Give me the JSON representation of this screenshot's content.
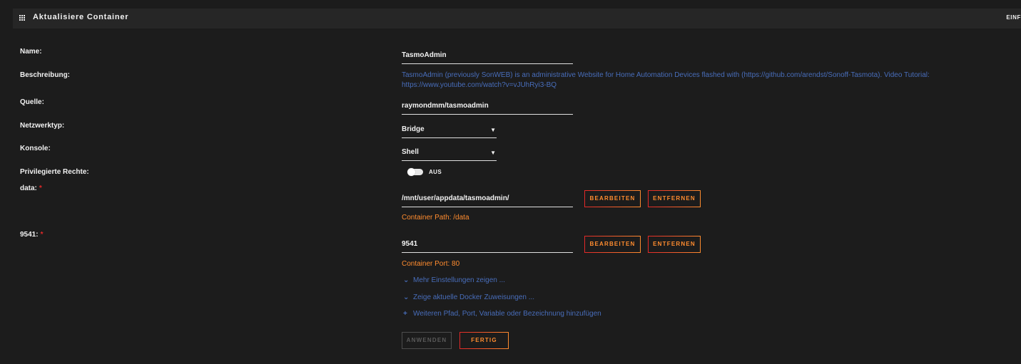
{
  "window": {
    "title": "Aktualisiere Container",
    "right_tab": "EINF"
  },
  "form": {
    "name": {
      "label": "Name:",
      "value": "TasmoAdmin"
    },
    "description": {
      "label": "Beschreibung:",
      "value": "TasmoAdmin (previously SonWEB) is an administrative Website for Home Automation Devices flashed with (https://github.com/arendst/Sonoff-Tasmota). Video Tutorial: https://www.youtube.com/watch?v=vJUhRyi3-BQ"
    },
    "source": {
      "label": "Quelle:",
      "value": "raymondmm/tasmoadmin"
    },
    "network": {
      "label": "Netzwerktyp:",
      "value": "Bridge"
    },
    "console": {
      "label": "Konsole:",
      "value": "Shell"
    },
    "privileged": {
      "label": "Privilegierte Rechte:",
      "state": "AUS"
    },
    "data_path": {
      "label": "data:",
      "required_mark": "*",
      "value": "/mnt/user/appdata/tasmoadmin/",
      "hint": "Container Path: /data",
      "edit_label": "BEARBEITEN",
      "remove_label": "ENTFERNEN"
    },
    "port": {
      "label": "9541:",
      "required_mark": "*",
      "value": "9541",
      "hint": "Container Port: 80",
      "edit_label": "BEARBEITEN",
      "remove_label": "ENTFERNEN"
    }
  },
  "links": {
    "more_settings": "Mehr Einstellungen zeigen ...",
    "docker_allocations": "Zeige aktuelle Docker Zuweisungen ...",
    "add_config": "Weiteren Pfad, Port, Variable oder Bezeichnung hinzufügen"
  },
  "actions": {
    "apply": "ANWENDEN",
    "done": "FERTIG"
  },
  "colors": {
    "accent": "#ff8c2f",
    "accent_red": "#e22828",
    "link": "#486dba",
    "background": "#1c1c1c"
  },
  "icons": {
    "title": "grid-icon",
    "expand": "chevron-down-icon",
    "add": "plus-icon",
    "select": "caret-down-icon"
  }
}
